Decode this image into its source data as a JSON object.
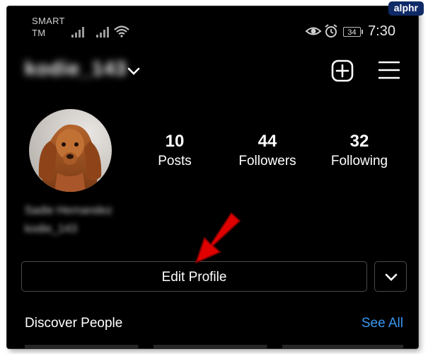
{
  "watermark": "alphr",
  "status_bar": {
    "carrier_line1": "SMART",
    "carrier_line2": "TM",
    "battery": "34",
    "time": "7:30"
  },
  "header": {
    "username": "kodie_143"
  },
  "profile": {
    "stats": [
      {
        "count": "10",
        "label": "Posts"
      },
      {
        "count": "44",
        "label": "Followers"
      },
      {
        "count": "32",
        "label": "Following"
      }
    ],
    "display_name": "Sadie Hernandez",
    "handle": "kodie_143"
  },
  "actions": {
    "edit_profile_label": "Edit Profile"
  },
  "discover": {
    "title": "Discover People",
    "see_all": "See All"
  },
  "colors": {
    "background": "#000000",
    "link": "#3897f0",
    "annotation_arrow": "#e00000"
  }
}
